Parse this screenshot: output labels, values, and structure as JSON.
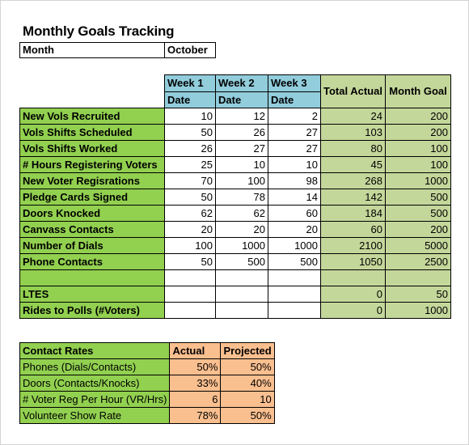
{
  "title": "Monthly Goals Tracking",
  "month": {
    "label": "Month",
    "value": "October"
  },
  "goals_table": {
    "week_headers": [
      "Week 1",
      "Week 2",
      "Week 3"
    ],
    "date_label": "Date",
    "total_header": "Total Actual",
    "goal_header": "Month Goal",
    "rows": [
      {
        "label": "New Vols Recruited",
        "w1": "10",
        "w2": "12",
        "w3": "2",
        "total": "24",
        "goal": "200"
      },
      {
        "label": "Vols Shifts Scheduled",
        "w1": "50",
        "w2": "26",
        "w3": "27",
        "total": "103",
        "goal": "200"
      },
      {
        "label": "Vols Shifts Worked",
        "w1": "26",
        "w2": "27",
        "w3": "27",
        "total": "80",
        "goal": "100"
      },
      {
        "label": "# Hours Registering Voters",
        "w1": "25",
        "w2": "10",
        "w3": "10",
        "total": "45",
        "goal": "100"
      },
      {
        "label": "New Voter Regisrations",
        "w1": "70",
        "w2": "100",
        "w3": "98",
        "total": "268",
        "goal": "1000"
      },
      {
        "label": "Pledge Cards Signed",
        "w1": "50",
        "w2": "78",
        "w3": "14",
        "total": "142",
        "goal": "500"
      },
      {
        "label": "Doors Knocked",
        "w1": "62",
        "w2": "62",
        "w3": "60",
        "total": "184",
        "goal": "500"
      },
      {
        "label": "Canvass Contacts",
        "w1": "20",
        "w2": "20",
        "w3": "20",
        "total": "60",
        "goal": "200"
      },
      {
        "label": "Number of Dials",
        "w1": "100",
        "w2": "1000",
        "w3": "1000",
        "total": "2100",
        "goal": "5000"
      },
      {
        "label": "Phone Contacts",
        "w1": "50",
        "w2": "500",
        "w3": "500",
        "total": "1050",
        "goal": "2500"
      },
      {
        "label": "",
        "w1": "",
        "w2": "",
        "w3": "",
        "total": "",
        "goal": ""
      },
      {
        "label": "LTES",
        "w1": "",
        "w2": "",
        "w3": "",
        "total": "0",
        "goal": "50"
      },
      {
        "label": "Rides to Polls (#Voters)",
        "w1": "",
        "w2": "",
        "w3": "",
        "total": "0",
        "goal": "1000"
      }
    ]
  },
  "rates_table": {
    "header": "Contact Rates",
    "actual_header": "Actual",
    "projected_header": "Projected",
    "rows": [
      {
        "label": "Phones (Dials/Contacts)",
        "actual": "50%",
        "projected": "50%"
      },
      {
        "label": "Doors (Contacts/Knocks)",
        "actual": "33%",
        "projected": "40%"
      },
      {
        "label": "# Voter Reg Per Hour (VR/Hrs)",
        "actual": "6",
        "projected": "10"
      },
      {
        "label": "Volunteer Show Rate",
        "actual": "78%",
        "projected": "50%"
      }
    ]
  },
  "colors": {
    "label_green": "#92d050",
    "week_blue": "#92cddc",
    "totals_olive": "#c4d79b",
    "rates_peach": "#fabf8f"
  }
}
